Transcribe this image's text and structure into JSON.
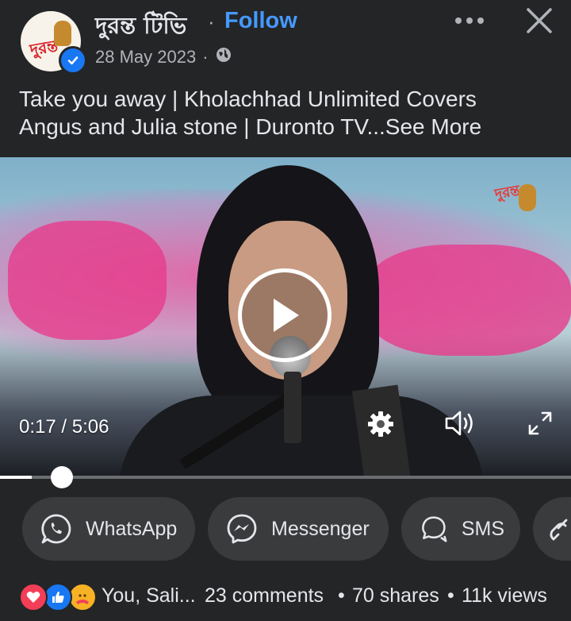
{
  "post": {
    "page_name": "দুরন্ত টিভি",
    "separator": "·",
    "follow_label": "Follow",
    "date": "28 May 2023",
    "meta_separator": "·",
    "audience_icon": "globe-icon",
    "caption_line1": "Take you away | Kholachhad Unlimited Covers",
    "caption_line2": "Angus and Julia stone | Duronto TV",
    "see_more_label": "...See More",
    "avatar_logo_text": "দুরন্ত",
    "watermark_text": "দুরন্ত"
  },
  "video": {
    "current_time": "0:17",
    "time_separator": "/",
    "duration": "5:06",
    "progress_fraction": 0.056
  },
  "share": {
    "items": [
      {
        "label": "WhatsApp",
        "icon": "whatsapp-icon"
      },
      {
        "label": "Messenger",
        "icon": "messenger-icon"
      },
      {
        "label": "SMS",
        "icon": "sms-icon"
      },
      {
        "label": "",
        "icon": "link-icon"
      }
    ]
  },
  "stats": {
    "reactors": "You, Sali...",
    "comments": "23 comments",
    "shares": "70 shares",
    "views": "11k views",
    "dot": "•"
  },
  "colors": {
    "background": "#242526",
    "accent": "#4599ff",
    "pill": "#3a3b3c",
    "love": "#f33e58",
    "like": "#1877f2",
    "care": "#f7b125"
  }
}
